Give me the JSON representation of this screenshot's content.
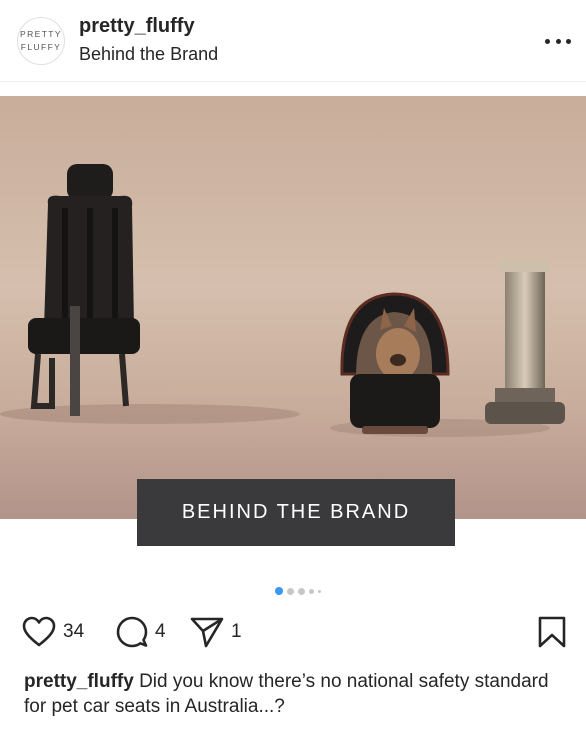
{
  "header": {
    "avatar_line1": "PRETTY",
    "avatar_line2": "FLUFFY",
    "username": "pretty_fluffy",
    "subtitle": "Behind the Brand"
  },
  "post": {
    "banner_text": "BEHIND THE BRAND",
    "carousel": {
      "total": 5,
      "current": 1,
      "accent": "#3897f0"
    }
  },
  "actions": {
    "likes": "34",
    "comments": "4",
    "shares": "1"
  },
  "caption": {
    "username": "pretty_fluffy",
    "text": "Did you know there’s no national safety standard for pet car seats in Australia...?"
  }
}
